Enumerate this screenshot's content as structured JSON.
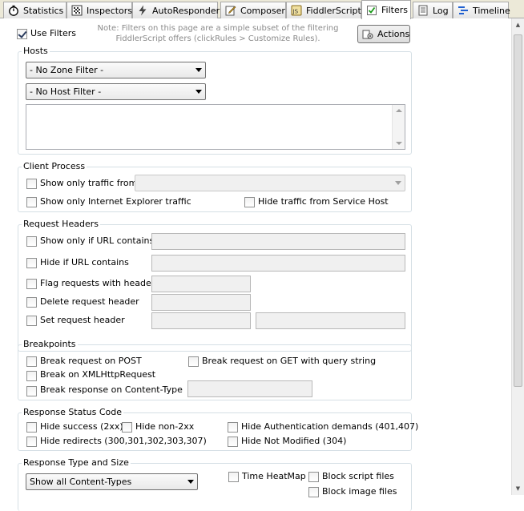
{
  "tabs": [
    {
      "label": "Statistics",
      "icon": "stopwatch-icon"
    },
    {
      "label": "Inspectors",
      "icon": "inspectors-icon"
    },
    {
      "label": "AutoResponder",
      "icon": "lightning-icon"
    },
    {
      "label": "Composer",
      "icon": "composer-icon"
    },
    {
      "label": "FiddlerScript",
      "icon": "script-icon"
    },
    {
      "label": "Filters",
      "icon": "checkbox-icon",
      "active": true
    },
    {
      "label": "Log",
      "icon": "log-icon"
    },
    {
      "label": "Timeline",
      "icon": "timeline-icon"
    }
  ],
  "top": {
    "use_filters_label": "Use Filters",
    "use_filters_checked": true,
    "note_line1": "Note: Filters on this page are a simple subset of the filtering",
    "note_line2": "FiddlerScript offers (clickRules > Customize Rules).",
    "actions_label": "Actions"
  },
  "hosts": {
    "title": "Hosts",
    "zone_filter": "- No Zone Filter -",
    "host_filter": "- No Host Filter -"
  },
  "client_process": {
    "title": "Client Process",
    "show_only_traffic_from": "Show only traffic from",
    "show_only_ie": "Show only Internet Explorer traffic",
    "hide_service_host": "Hide traffic from Service Host"
  },
  "request_headers": {
    "title": "Request Headers",
    "show_only_url": "Show only if URL contains",
    "hide_url": "Hide if URL contains",
    "flag_requests": "Flag requests with header",
    "delete_header": "Delete request header",
    "set_header": "Set request header"
  },
  "breakpoints": {
    "title": "Breakpoints",
    "break_post": "Break request on POST",
    "break_get": "Break request on GET with query string",
    "break_xhr": "Break on XMLHttpRequest",
    "break_content_type": "Break response on Content-Type"
  },
  "response_status": {
    "title": "Response Status Code",
    "hide_success": "Hide success (2xx)",
    "hide_non2xx": "Hide non-2xx",
    "hide_auth": "Hide Authentication demands (401,407)",
    "hide_redirects": "Hide redirects (300,301,302,303,307)",
    "hide_not_modified": "Hide Not Modified (304)"
  },
  "response_type": {
    "title": "Response Type and Size",
    "content_types": "Show all Content-Types",
    "time_heatmap": "Time HeatMap",
    "block_script": "Block script files",
    "block_image": "Block image files"
  }
}
